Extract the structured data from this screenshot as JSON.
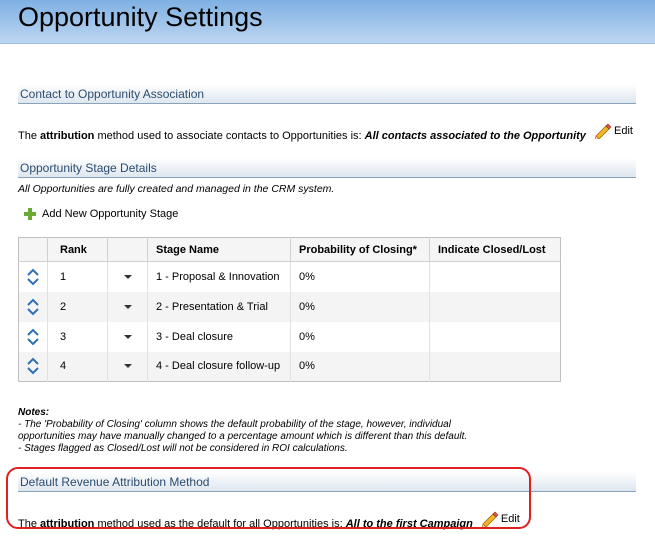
{
  "page_title": "Opportunity Settings",
  "contact_section": {
    "heading": "Contact to Opportunity Association",
    "text_pre": "The ",
    "text_bold": "attribution",
    "text_mid": " method used to associate contacts to Opportunities is: ",
    "value": "All contacts associated to the Opportunity",
    "edit_label": "Edit"
  },
  "stage_section": {
    "heading": "Opportunity Stage Details",
    "subtext": "All Opportunities are fully created and managed in the CRM system.",
    "add_label": "Add New Opportunity Stage",
    "columns": [
      "",
      "Rank",
      "",
      "Stage Name",
      "Probability of Closing*",
      "Indicate Closed/Lost"
    ],
    "rows": [
      {
        "rank": "1",
        "stage": "1 - Proposal & Innovation",
        "probability": "0%",
        "closed_lost": ""
      },
      {
        "rank": "2",
        "stage": "2 - Presentation & Trial",
        "probability": "0%",
        "closed_lost": ""
      },
      {
        "rank": "3",
        "stage": "3 - Deal closure",
        "probability": "0%",
        "closed_lost": ""
      },
      {
        "rank": "4",
        "stage": "4 - Deal closure follow-up",
        "probability": "0%",
        "closed_lost": ""
      }
    ]
  },
  "notes": {
    "title": "Notes:",
    "line1": "- The 'Probability of Closing' column shows the default probability of the stage, however, individual",
    "line2": "opportunities may have manually changed to a percentage amount which is different than this default.",
    "line3": "- Stages flagged as Closed/Lost will not be considered in ROI calculations."
  },
  "revenue_section": {
    "heading": "Default Revenue Attribution Method",
    "text_pre": "The ",
    "text_bold": "attribution",
    "text_mid": " method used as the default for all Opportunities is: ",
    "value": "All to the first Campaign",
    "edit_label": "Edit"
  },
  "colors": {
    "header_top": "#7fb0e3",
    "section_text": "#2b4c6f",
    "add_icon": "#6aab34",
    "highlight": "#e02020"
  }
}
